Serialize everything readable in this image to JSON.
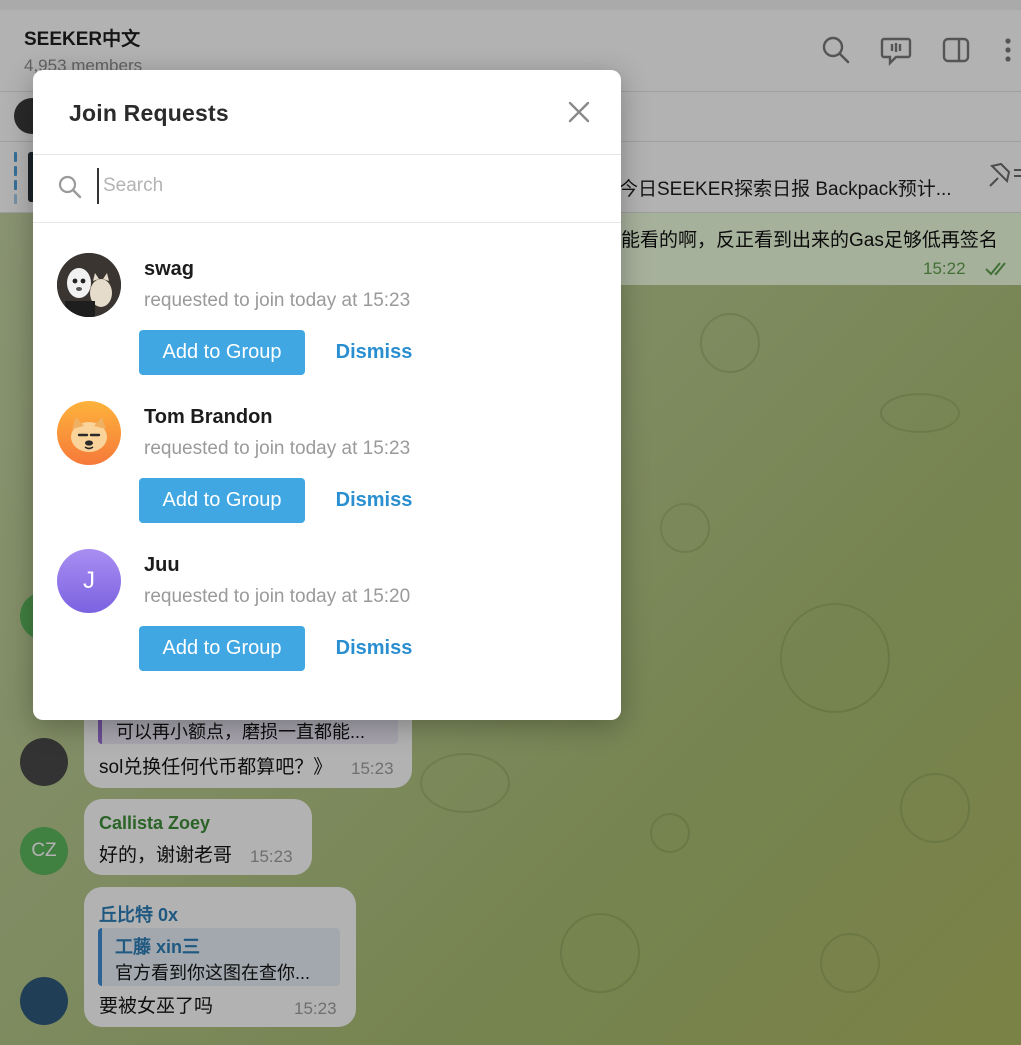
{
  "chat": {
    "title": "SEEKER中文",
    "members": "4,953 members",
    "pinned_text": "今日SEEKER探索日报  Backpack预计...",
    "top_message": "能看的啊，反正看到出来的Gas足够低再签名",
    "top_time": "15:22",
    "messages": [
      {
        "quote": "可以再小额点，磨损一直都能...",
        "text": "sol兑换任何代币都算吧？》",
        "time": "15:23"
      },
      {
        "sender": "Callista Zoey",
        "initials": "CZ",
        "text": "好的，谢谢老哥",
        "time": "15:23"
      },
      {
        "sender": "丘比特 0x",
        "quote_sender": "工藤 xin三",
        "quote": "官方看到你这图在查你...",
        "text": "要被女巫了吗",
        "time": "15:23"
      }
    ]
  },
  "modal": {
    "title": "Join Requests",
    "search_placeholder": "Search",
    "requests": [
      {
        "name": "swag",
        "subtitle": "requested to join today at 15:23",
        "add_label": "Add to Group",
        "dismiss_label": "Dismiss"
      },
      {
        "name": "Tom Brandon",
        "subtitle": "requested to join today at 15:23",
        "add_label": "Add to Group",
        "dismiss_label": "Dismiss"
      },
      {
        "name": "Juu",
        "initial": "J",
        "subtitle": "requested to join today at 15:20",
        "add_label": "Add to Group",
        "dismiss_label": "Dismiss"
      }
    ]
  },
  "colors": {
    "accent": "#40a7e3",
    "link": "#2a8fd0",
    "callista_name": "#3f8f3a",
    "qiubite_name": "#2d7fb8"
  }
}
